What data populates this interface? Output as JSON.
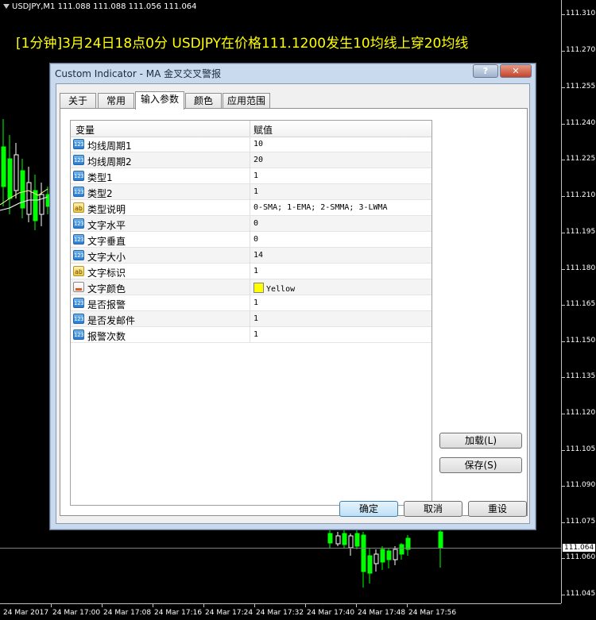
{
  "chart": {
    "header": "USDJPY,M1  111.088 111.088 111.056 111.064",
    "alert_text": "[1分钟]3月24日18点0分 USDJPY在价格111.1200发生10均线上穿20均线",
    "price_labels": [
      "111.310",
      "111.270",
      "111.255",
      "111.240",
      "111.225",
      "111.210",
      "111.195",
      "111.180",
      "111.165",
      "111.150",
      "111.135",
      "111.120",
      "111.105",
      "111.090",
      "111.075",
      "111.060",
      "111.045"
    ],
    "current_price": "111.064",
    "time_labels": [
      "24 Mar 2017",
      "24 Mar 17:00",
      "24 Mar 17:08",
      "24 Mar 17:16",
      "24 Mar 17:24",
      "24 Mar 17:32",
      "24 Mar 17:40",
      "24 Mar 17:48",
      "24 Mar 17:56"
    ],
    "bullish_color": "#00ff00",
    "bearish_color": "#ffffff"
  },
  "dialog": {
    "title": "Custom Indicator - MA 金叉交叉警报",
    "help_label": "?",
    "close_label": "✕",
    "tabs": [
      "关于",
      "常用",
      "输入参数",
      "颜色",
      "应用范围"
    ],
    "active_tab": "输入参数",
    "columns": {
      "variable": "变量",
      "value": "赋值"
    },
    "params": [
      {
        "icon": "number-icon",
        "type": "num",
        "name": "均线周期1",
        "value": "10"
      },
      {
        "icon": "number-icon",
        "type": "num",
        "name": "均线周期2",
        "value": "20"
      },
      {
        "icon": "number-icon",
        "type": "num",
        "name": "类型1",
        "value": "1"
      },
      {
        "icon": "number-icon",
        "type": "num",
        "name": "类型2",
        "value": "1"
      },
      {
        "icon": "text-icon",
        "type": "txt",
        "name": "类型说明",
        "value": "0-SMA; 1-EMA; 2-SMMA; 3-LWMA"
      },
      {
        "icon": "number-icon",
        "type": "num",
        "name": "文字水平",
        "value": "0"
      },
      {
        "icon": "number-icon",
        "type": "num",
        "name": "文字垂直",
        "value": "0"
      },
      {
        "icon": "number-icon",
        "type": "num",
        "name": "文字大小",
        "value": "14"
      },
      {
        "icon": "text-icon",
        "type": "txt",
        "name": "文字标识",
        "value": "1"
      },
      {
        "icon": "color-icon",
        "type": "clr",
        "name": "文字颜色",
        "value": "Yellow",
        "swatch": "#ffff00"
      },
      {
        "icon": "number-icon",
        "type": "num",
        "name": "是否报警",
        "value": "1"
      },
      {
        "icon": "number-icon",
        "type": "num",
        "name": "是否发邮件",
        "value": "1"
      },
      {
        "icon": "number-icon",
        "type": "num",
        "name": "报警次数",
        "value": "1"
      }
    ],
    "buttons": {
      "load": "加载(L)",
      "save": "保存(S)",
      "ok": "确定",
      "cancel": "取消",
      "reset": "重设"
    }
  }
}
